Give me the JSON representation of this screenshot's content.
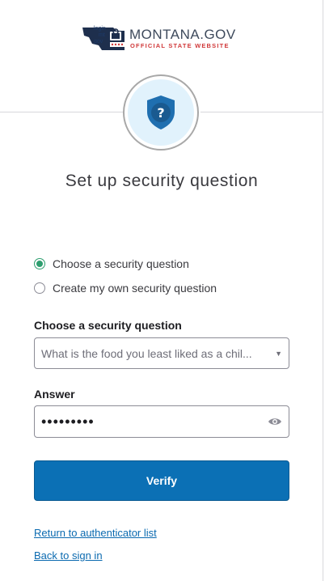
{
  "header": {
    "logo_small_lines": [
      "login",
      "mt",
      "gov"
    ],
    "logo_title": "MONTANA.GOV",
    "logo_subtitle": "OFFICIAL STATE WEBSITE"
  },
  "badge": {
    "icon": "shield-question-icon"
  },
  "page": {
    "title": "Set up security question"
  },
  "options": [
    {
      "label": "Choose a security question",
      "checked": true
    },
    {
      "label": "Create my own security question",
      "checked": false
    }
  ],
  "question_field": {
    "label": "Choose a security question",
    "selected": "What is the food you least liked as a chil..."
  },
  "answer_field": {
    "label": "Answer",
    "masked_value": "•••••••••"
  },
  "verify_label": "Verify",
  "links": {
    "return": "Return to authenticator list",
    "back": "Back to sign in"
  },
  "colors": {
    "accent": "#0b70b5",
    "radio_checked": "#2e9e6f",
    "shield": "#1f6fb0"
  }
}
